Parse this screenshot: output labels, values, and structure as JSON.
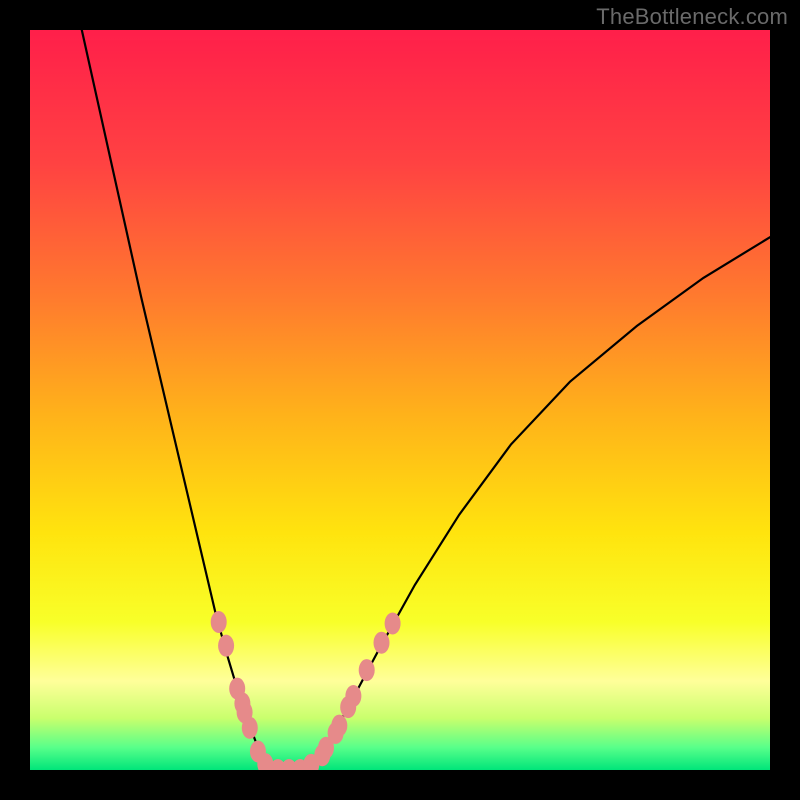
{
  "watermark": {
    "text": "TheBottleneck.com"
  },
  "chart_data": {
    "type": "line",
    "title": "",
    "xlabel": "",
    "ylabel": "",
    "xlim": [
      0,
      1
    ],
    "ylim": [
      0,
      1
    ],
    "grid": false,
    "legend": false,
    "background_gradient_stops": [
      {
        "offset": 0.0,
        "color": "#ff1f4a"
      },
      {
        "offset": 0.18,
        "color": "#ff4242"
      },
      {
        "offset": 0.36,
        "color": "#ff7a2e"
      },
      {
        "offset": 0.52,
        "color": "#ffb21a"
      },
      {
        "offset": 0.68,
        "color": "#ffe40e"
      },
      {
        "offset": 0.8,
        "color": "#f8ff29"
      },
      {
        "offset": 0.88,
        "color": "#ffff9a"
      },
      {
        "offset": 0.93,
        "color": "#c9ff6d"
      },
      {
        "offset": 0.97,
        "color": "#57ff8a"
      },
      {
        "offset": 1.0,
        "color": "#00e57a"
      }
    ],
    "series": [
      {
        "name": "curve-left",
        "x": [
          0.07,
          0.09,
          0.11,
          0.13,
          0.15,
          0.17,
          0.19,
          0.21,
          0.23,
          0.25,
          0.265,
          0.28,
          0.295,
          0.31,
          0.32
        ],
        "y": [
          1.0,
          0.91,
          0.82,
          0.73,
          0.64,
          0.555,
          0.47,
          0.385,
          0.3,
          0.215,
          0.16,
          0.11,
          0.065,
          0.025,
          0.005
        ]
      },
      {
        "name": "curve-bottom",
        "x": [
          0.32,
          0.34,
          0.36,
          0.38
        ],
        "y": [
          0.005,
          0.0,
          0.0,
          0.005
        ]
      },
      {
        "name": "curve-right",
        "x": [
          0.38,
          0.4,
          0.43,
          0.47,
          0.52,
          0.58,
          0.65,
          0.73,
          0.82,
          0.91,
          1.0
        ],
        "y": [
          0.005,
          0.03,
          0.085,
          0.16,
          0.25,
          0.345,
          0.44,
          0.525,
          0.6,
          0.665,
          0.72
        ]
      }
    ],
    "markers": {
      "name": "scatter-points",
      "color": "#e68a8a",
      "points": [
        {
          "x": 0.255,
          "y": 0.2
        },
        {
          "x": 0.265,
          "y": 0.168
        },
        {
          "x": 0.28,
          "y": 0.11
        },
        {
          "x": 0.287,
          "y": 0.09
        },
        {
          "x": 0.29,
          "y": 0.078
        },
        {
          "x": 0.297,
          "y": 0.057
        },
        {
          "x": 0.308,
          "y": 0.025
        },
        {
          "x": 0.318,
          "y": 0.008
        },
        {
          "x": 0.335,
          "y": 0.0
        },
        {
          "x": 0.35,
          "y": 0.0
        },
        {
          "x": 0.365,
          "y": 0.0
        },
        {
          "x": 0.38,
          "y": 0.007
        },
        {
          "x": 0.395,
          "y": 0.02
        },
        {
          "x": 0.4,
          "y": 0.03
        },
        {
          "x": 0.413,
          "y": 0.05
        },
        {
          "x": 0.418,
          "y": 0.06
        },
        {
          "x": 0.43,
          "y": 0.085
        },
        {
          "x": 0.437,
          "y": 0.1
        },
        {
          "x": 0.455,
          "y": 0.135
        },
        {
          "x": 0.475,
          "y": 0.172
        },
        {
          "x": 0.49,
          "y": 0.198
        }
      ]
    }
  }
}
